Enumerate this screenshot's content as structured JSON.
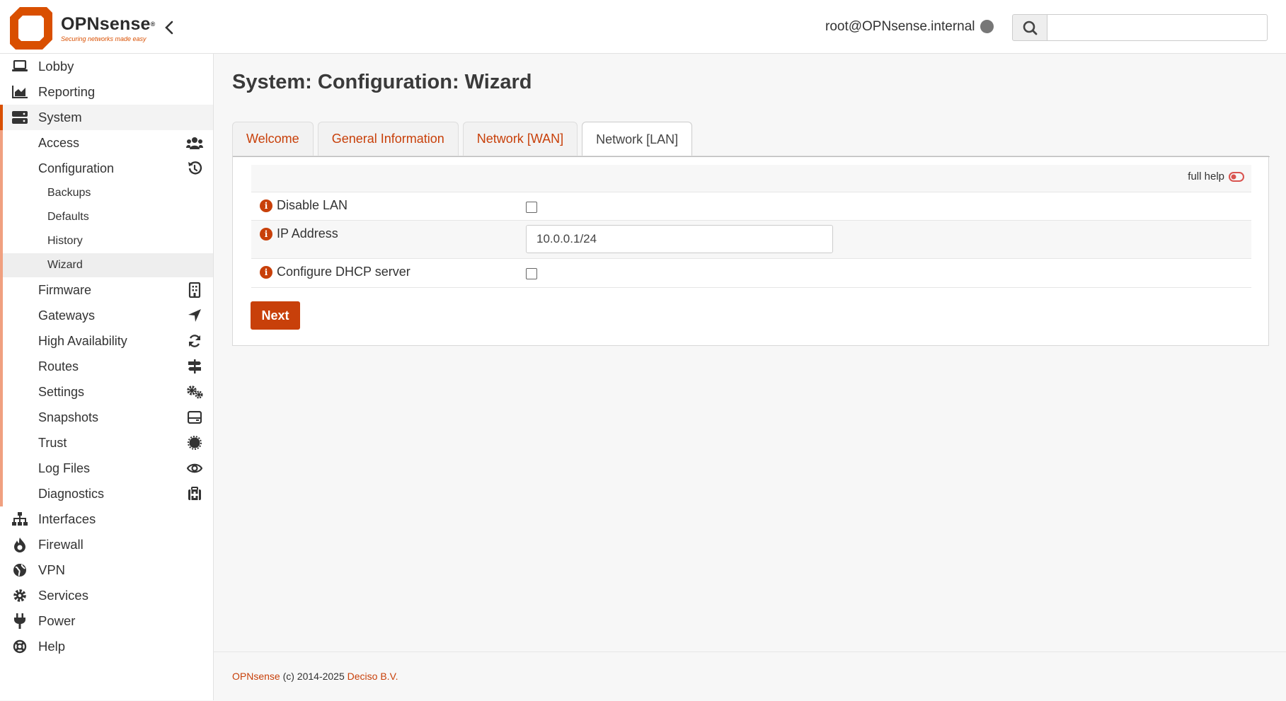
{
  "header": {
    "brand_name": "OPNsense",
    "brand_mark": "®",
    "tagline": "Securing networks made easy",
    "user": "root@OPNsense.internal",
    "search_placeholder": "",
    "brand_color": "#d94f00"
  },
  "sidebar": {
    "top_items": [
      {
        "label": "Lobby",
        "icon": "laptop-icon"
      },
      {
        "label": "Reporting",
        "icon": "area-chart-icon"
      },
      {
        "label": "System",
        "icon": "server-icon"
      }
    ],
    "system_items": [
      {
        "label": "Access",
        "icon": "users-icon"
      },
      {
        "label": "Configuration",
        "icon": "history-icon"
      },
      {
        "label": "Firmware",
        "icon": "building-icon"
      },
      {
        "label": "Gateways",
        "icon": "location-arrow-icon"
      },
      {
        "label": "High Availability",
        "icon": "refresh-icon"
      },
      {
        "label": "Routes",
        "icon": "signs-icon"
      },
      {
        "label": "Settings",
        "icon": "cogs-icon"
      },
      {
        "label": "Snapshots",
        "icon": "hdd-icon"
      },
      {
        "label": "Trust",
        "icon": "certificate-icon"
      },
      {
        "label": "Log Files",
        "icon": "eye-icon"
      },
      {
        "label": "Diagnostics",
        "icon": "medkit-icon"
      }
    ],
    "configuration_items": [
      {
        "label": "Backups"
      },
      {
        "label": "Defaults"
      },
      {
        "label": "History"
      },
      {
        "label": "Wizard"
      }
    ],
    "bottom_items": [
      {
        "label": "Interfaces",
        "icon": "sitemap-icon"
      },
      {
        "label": "Firewall",
        "icon": "fire-icon"
      },
      {
        "label": "VPN",
        "icon": "globe-icon"
      },
      {
        "label": "Services",
        "icon": "cog-icon"
      },
      {
        "label": "Power",
        "icon": "plug-icon"
      },
      {
        "label": "Help",
        "icon": "life-ring-icon"
      }
    ]
  },
  "main": {
    "title": "System: Configuration: Wizard",
    "tabs": [
      {
        "label": "Welcome",
        "active": false
      },
      {
        "label": "General Information",
        "active": false
      },
      {
        "label": "Network [WAN]",
        "active": false
      },
      {
        "label": "Network [LAN]",
        "active": true
      }
    ],
    "full_help_label": "full help",
    "fields": {
      "disable_lan": {
        "label": "Disable LAN",
        "checked": false
      },
      "ip_address": {
        "label": "IP Address",
        "value": "10.0.0.1/24"
      },
      "dhcp": {
        "label": "Configure DHCP server",
        "checked": false
      }
    },
    "next_label": "Next"
  },
  "footer": {
    "product_link": "OPNsense",
    "copyright": " (c) 2014-2025 ",
    "company_link": "Deciso B.V."
  }
}
